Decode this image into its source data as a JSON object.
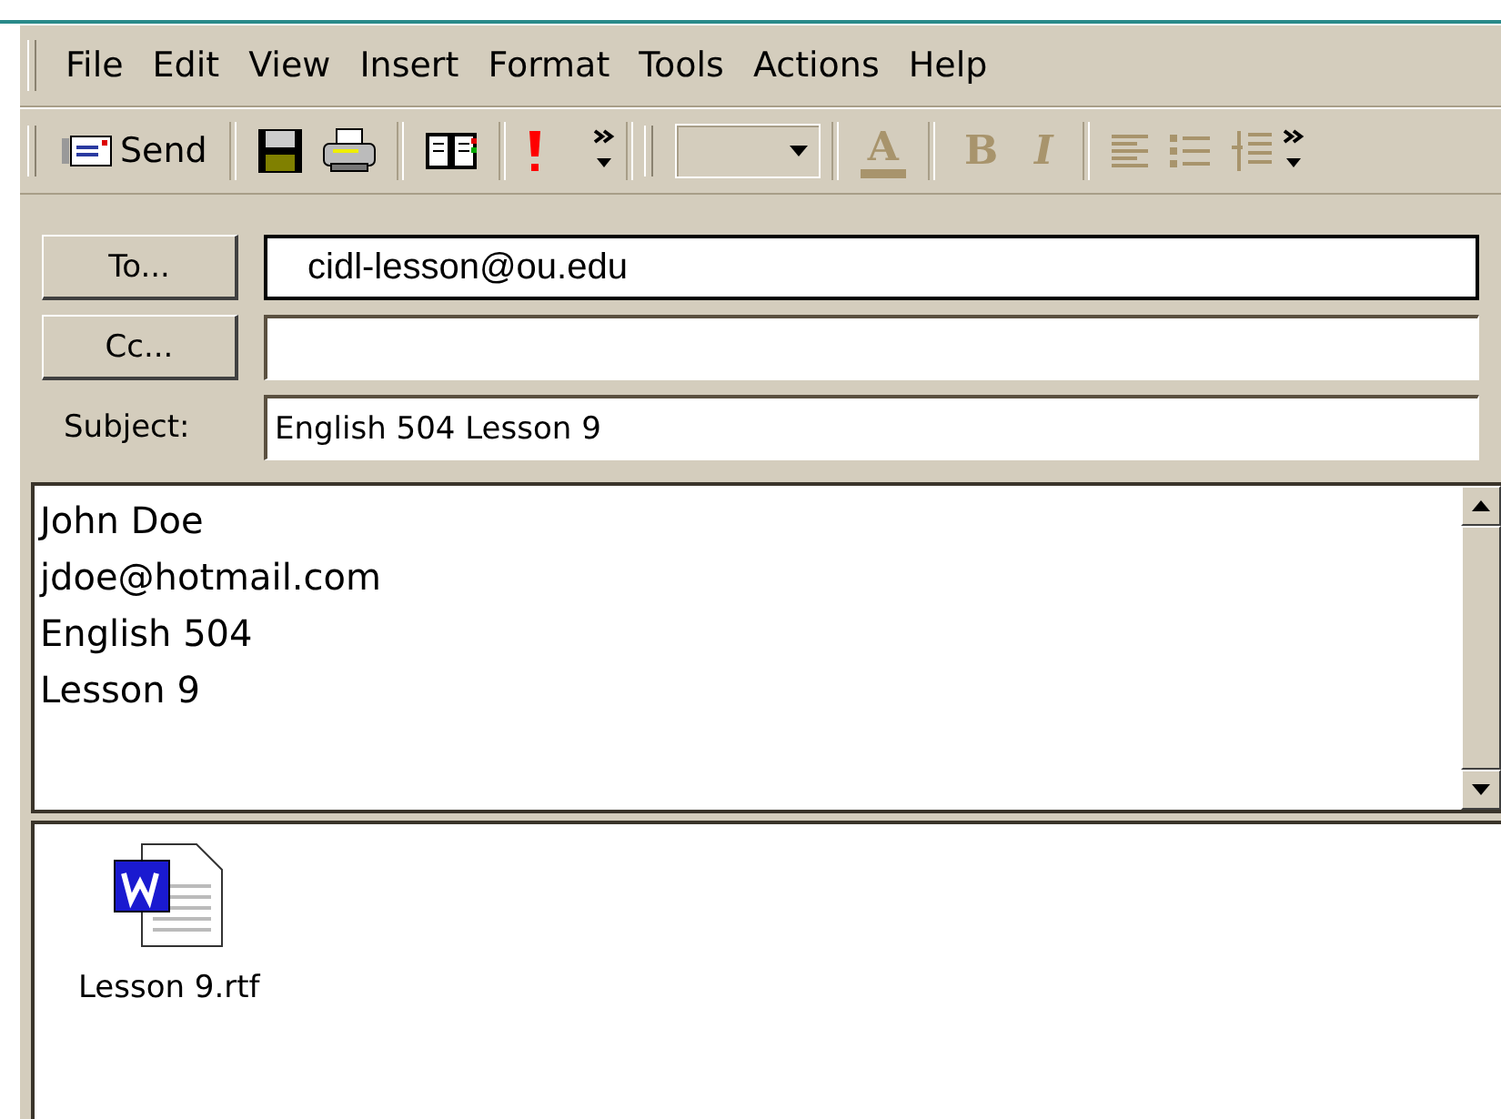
{
  "menu": [
    {
      "label": "File"
    },
    {
      "label": "Edit"
    },
    {
      "label": "View"
    },
    {
      "label": "Insert"
    },
    {
      "label": "Format"
    },
    {
      "label": "Tools"
    },
    {
      "label": "Actions"
    },
    {
      "label": "Help"
    }
  ],
  "toolbar": {
    "send": {
      "label": "Send"
    },
    "format_buttons": [
      {
        "label": "A",
        "kind": "color",
        "disabled": true
      },
      {
        "label": "B",
        "kind": "bold",
        "disabled": true
      },
      {
        "label": "I",
        "kind": "italic",
        "disabled": true
      }
    ]
  },
  "to": {
    "button": "To...",
    "value": "cidl-lesson@ou.edu"
  },
  "cc": {
    "button": "Cc..."
  },
  "subject": {
    "label": "Subject:",
    "value": "English 504 Lesson 9"
  },
  "body": [
    "John Doe",
    "jdoe@hotmail.com",
    "English 504",
    "Lesson 9"
  ],
  "attachments": [
    {
      "name": "Lesson 9.rtf"
    }
  ]
}
